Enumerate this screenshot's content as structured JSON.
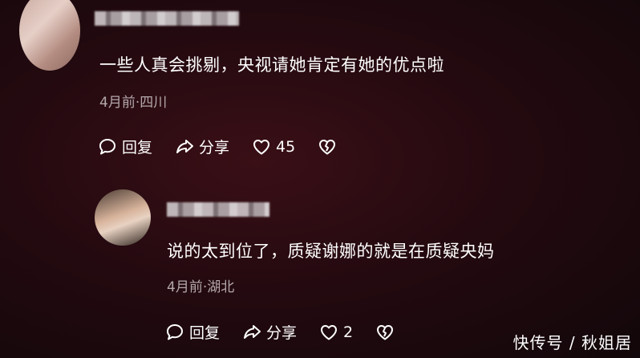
{
  "comments": [
    {
      "text": "一些人真会挑剔，央视请她肯定有她的优点啦",
      "meta": "4月前·四川",
      "reply_label": "回复",
      "share_label": "分享",
      "like_count": "45"
    },
    {
      "text": "说的太到位了，质疑谢娜的就是在质疑央妈",
      "meta": "4月前·湖北",
      "reply_label": "回复",
      "share_label": "分享",
      "like_count": "2"
    }
  ],
  "watermark": "快传号 / 秋姐居",
  "icons": {
    "reply": "comment-bubble-icon",
    "share": "share-arrow-icon",
    "like": "heart-icon",
    "dislike": "broken-heart-icon"
  }
}
